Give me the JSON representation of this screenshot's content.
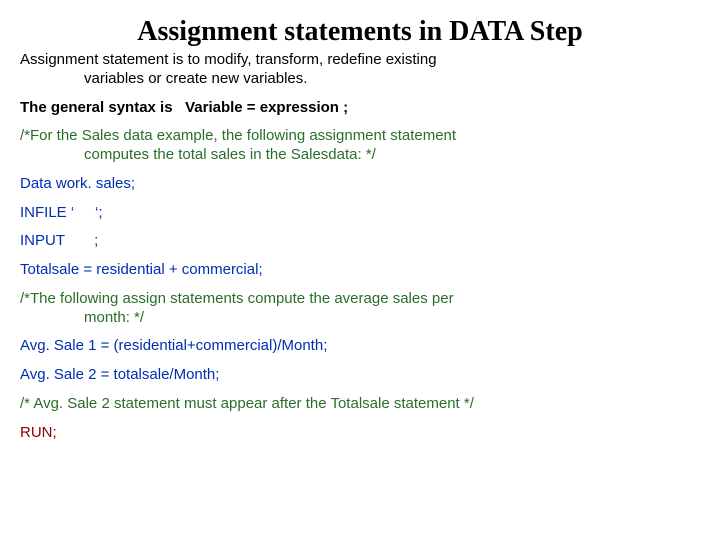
{
  "title": "Assignment statements in DATA Step",
  "intro_line1": "Assignment statement is to modify, transform, redefine existing",
  "intro_line2": "variables or create new variables.",
  "syntax_label": "The general syntax is",
  "syntax_pad": "   ",
  "syntax_expr": "Variable = expression ;",
  "comment1_line1": "/*For the Sales data example, the following assignment statement",
  "comment1_line2": "computes the total sales in the Salesdata: */",
  "code": {
    "data_l": "Data",
    "data_r": " work. sales;",
    "infile_l": "INFILE",
    "infile_r": " ‘     ‘;",
    "input_l": "INPUT",
    "input_r": "       ;",
    "totalsale": "Totalsale = residential + commercial;"
  },
  "comment2_line1": "/*The following assign statements compute the average sales per",
  "comment2_line2": "month: */",
  "avg1": "Avg. Sale 1 = (residential+commercial)/Month;",
  "avg2": "Avg. Sale 2 = totalsale/Month;",
  "comment3": "/* Avg. Sale 2 statement must appear after the Totalsale statement */",
  "run": "RUN;"
}
